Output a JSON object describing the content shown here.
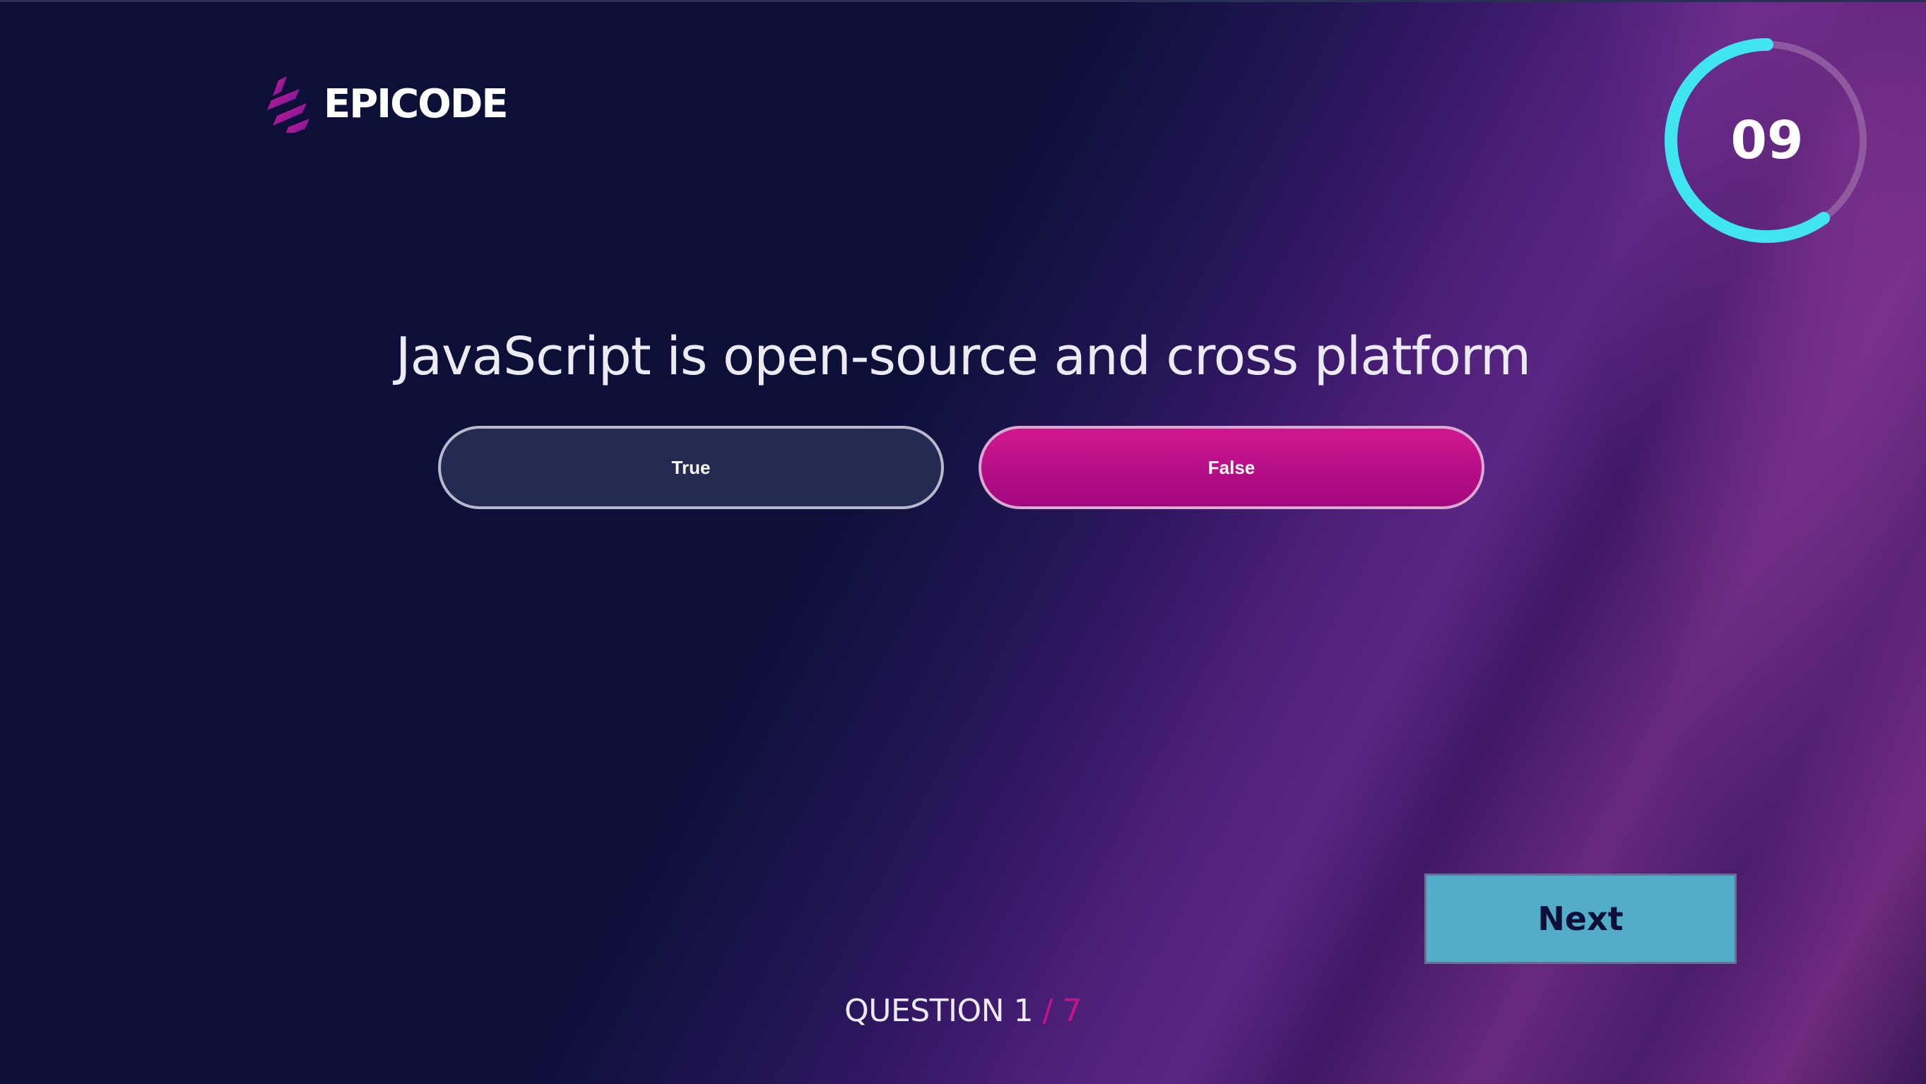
{
  "brand": {
    "name": "EPICODE",
    "logo_icon": "epicode-stripes-icon"
  },
  "timer": {
    "value": "09",
    "remaining_fraction": 0.6,
    "ring_color": "#3fe6f0",
    "track_color": "#9a6aa6"
  },
  "question": {
    "text": "JavaScript is open-source and cross platform"
  },
  "answers": [
    {
      "label": "True"
    },
    {
      "label": "False"
    }
  ],
  "actions": {
    "next_label": "Next"
  },
  "progress": {
    "prefix": "QUESTION ",
    "current": "1",
    "separator": " / ",
    "total": "7"
  },
  "colors": {
    "background": "#0c1039",
    "accent_magenta": "#c41585",
    "next_button": "#52adc8"
  }
}
